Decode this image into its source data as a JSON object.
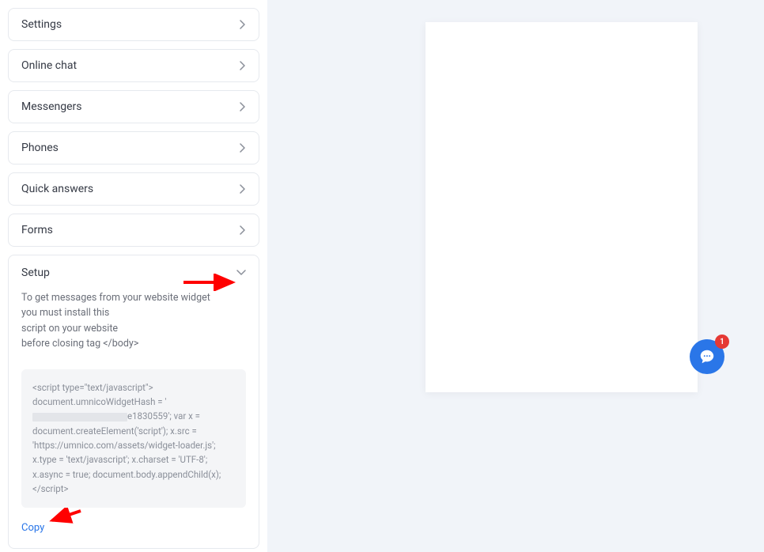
{
  "sidebar": {
    "items": [
      {
        "label": "Settings"
      },
      {
        "label": "Online chat"
      },
      {
        "label": "Messengers"
      },
      {
        "label": "Phones"
      },
      {
        "label": "Quick answers"
      },
      {
        "label": "Forms"
      }
    ]
  },
  "setup": {
    "title": "Setup",
    "desc_line1": "To get messages from your website widget",
    "desc_line2": "you must install this",
    "desc_line3": "script on your website",
    "desc_line4": "before closing tag </body>",
    "code_prefix": "<script type=\"text/javascript\"> document.umnicoWidgetHash = '",
    "code_suffix": "e1830559'; var x = document.createElement('script'); x.src = 'https://umnico.com/assets/widget-loader.js'; x.type = 'text/javascript'; x.charset = 'UTF-8'; x.async = true; document.body.appendChild(x); </scr",
    "code_suffix2": "ipt>",
    "copy_label": "Copy"
  },
  "chat": {
    "badge_count": "1"
  }
}
